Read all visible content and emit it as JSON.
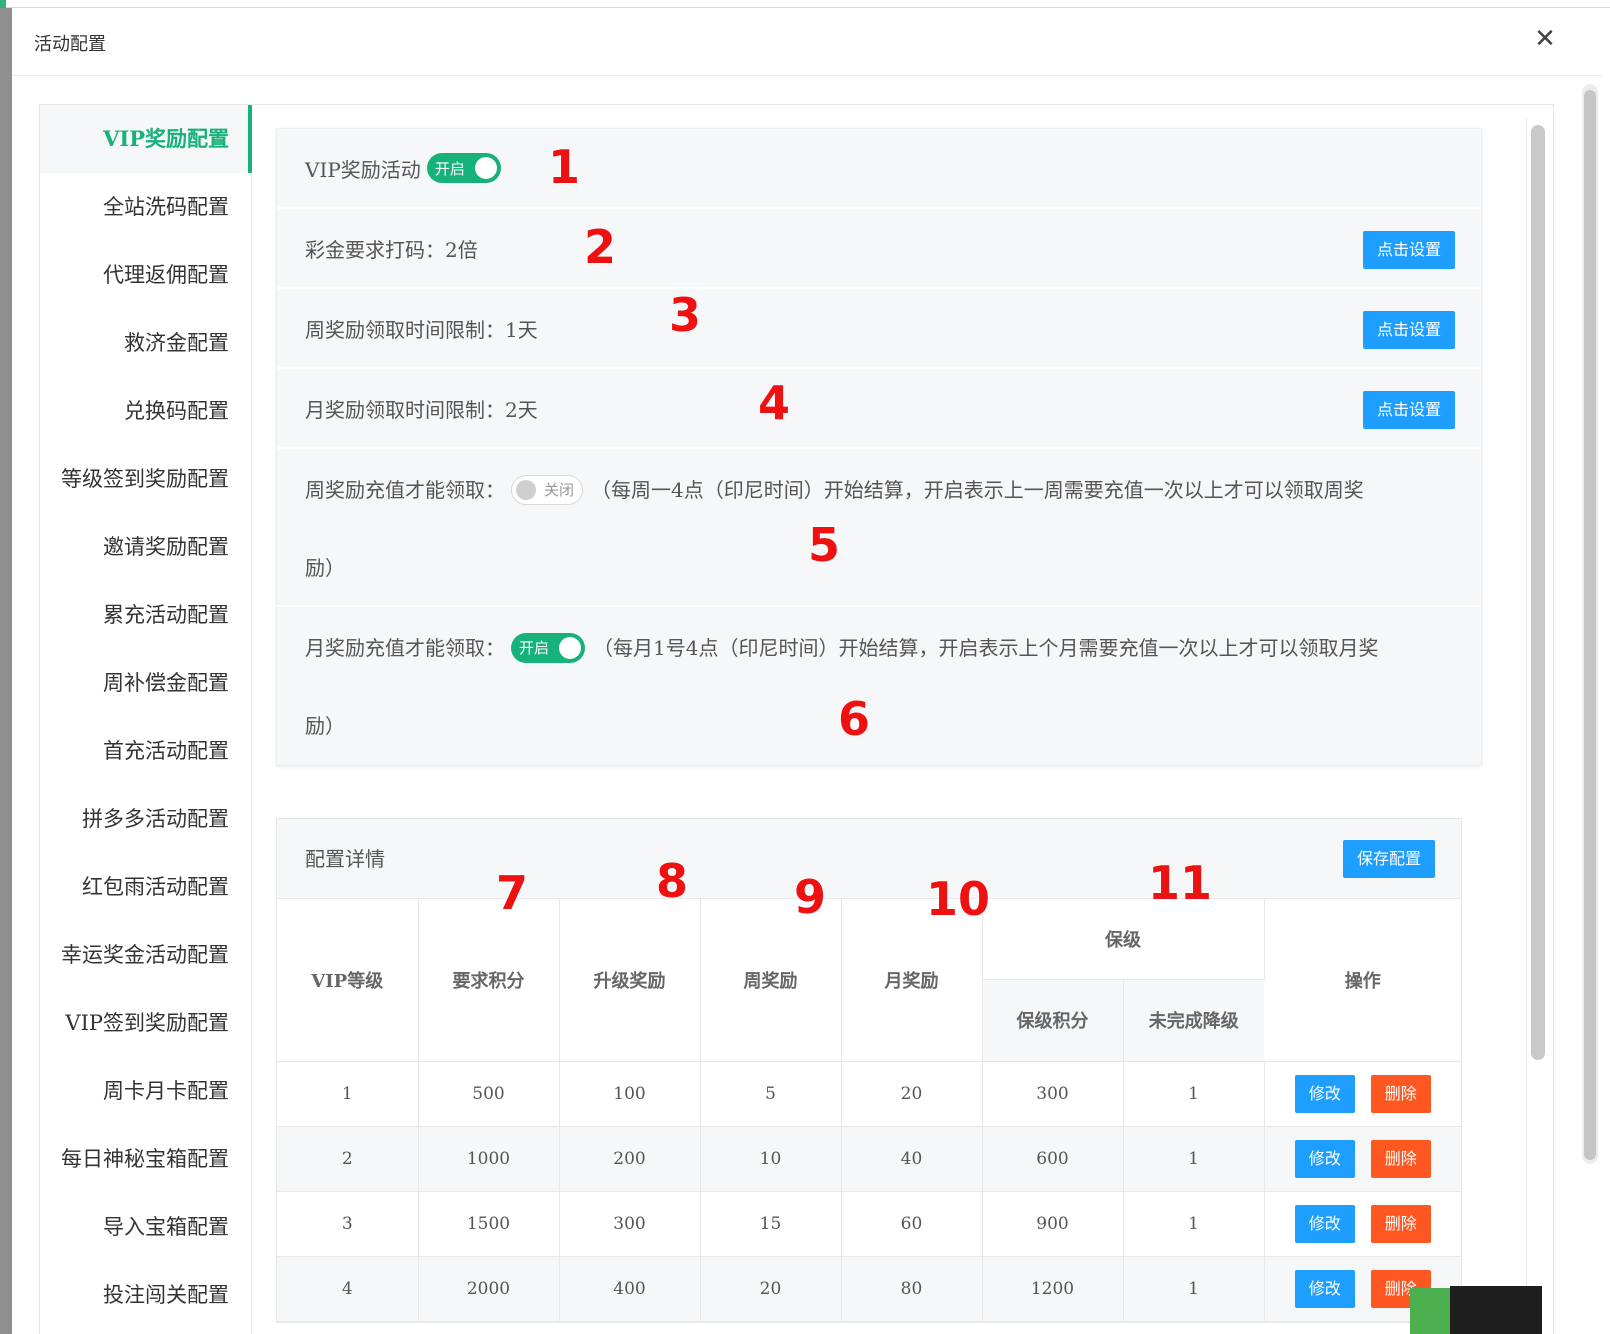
{
  "modal": {
    "title": "活动配置",
    "close_icon": "close-icon"
  },
  "sidebar": {
    "items": [
      {
        "label": "VIP奖励配置",
        "active": true
      },
      {
        "label": "全站洗码配置"
      },
      {
        "label": "代理返佣配置"
      },
      {
        "label": "救济金配置"
      },
      {
        "label": "兑换码配置"
      },
      {
        "label": "等级签到奖励配置"
      },
      {
        "label": "邀请奖励配置"
      },
      {
        "label": "累充活动配置"
      },
      {
        "label": "周补偿金配置"
      },
      {
        "label": "首充活动配置"
      },
      {
        "label": "拼多多活动配置"
      },
      {
        "label": "红包雨活动配置"
      },
      {
        "label": "幸运奖金活动配置"
      },
      {
        "label": "VIP签到奖励配置"
      },
      {
        "label": "周卡月卡配置"
      },
      {
        "label": "每日神秘宝箱配置"
      },
      {
        "label": "导入宝箱配置"
      },
      {
        "label": "投注闯关配置"
      }
    ]
  },
  "settings": {
    "vip_activity": {
      "label": "VIP奖励活动",
      "toggle": "开启"
    },
    "bonus_wager": {
      "label": "彩金要求打码：2倍",
      "button": "点击设置"
    },
    "weekly_limit": {
      "label": "周奖励领取时间限制：1天",
      "button": "点击设置"
    },
    "monthly_limit": {
      "label": "月奖励领取时间限制：2天",
      "button": "点击设置"
    },
    "weekly_recharge": {
      "label": "周奖励充值才能领取：",
      "toggle": "关闭",
      "desc": "（每周一4点（印尼时间）开始结算，开启表示上一周需要充值一次以上才可以领取周奖",
      "desc_cont": "励）"
    },
    "monthly_recharge": {
      "label": "月奖励充值才能领取：",
      "toggle": "开启",
      "desc": "（每月1号4点（印尼时间）开始结算，开启表示上个月需要充值一次以上才可以领取月奖",
      "desc_cont": "励）"
    }
  },
  "annotations": [
    "1",
    "2",
    "3",
    "4",
    "5",
    "6",
    "7",
    "8",
    "9",
    "10",
    "11"
  ],
  "details": {
    "title": "配置详情",
    "save_button": "保存配置",
    "headers": {
      "vip_level": "VIP等级",
      "required_points": "要求积分",
      "upgrade_reward": "升级奖励",
      "weekly_reward": "周奖励",
      "monthly_reward": "月奖励",
      "protect": "保级",
      "protect_points": "保级积分",
      "downgrade": "未完成降级",
      "actions": "操作"
    },
    "edit_label": "修改",
    "delete_label": "删除",
    "rows": [
      [
        "1",
        "500",
        "100",
        "5",
        "20",
        "300",
        "1"
      ],
      [
        "2",
        "1000",
        "200",
        "10",
        "40",
        "600",
        "1"
      ],
      [
        "3",
        "1500",
        "300",
        "15",
        "60",
        "900",
        "1"
      ],
      [
        "4",
        "2000",
        "400",
        "20",
        "80",
        "1200",
        "1"
      ]
    ]
  },
  "colors": {
    "accent": "#16b27a",
    "primary_button": "#1e9fff",
    "danger_button": "#ff5722",
    "annotation": "#ee1111"
  }
}
